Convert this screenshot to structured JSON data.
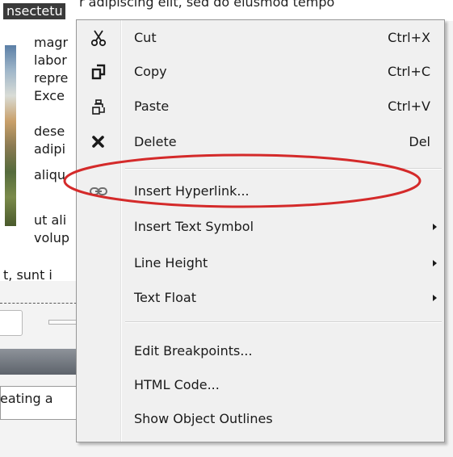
{
  "document": {
    "selected_word": "nsectetu",
    "top_line_text": "r adipiscing elit, sed do eiusmod tempo",
    "side_lines": [
      "magr",
      "labor",
      "repre",
      "Exce",
      "dese",
      "adipi",
      "aliqu",
      "ut ali",
      "volup"
    ],
    "bottom_line": "t, sunt i",
    "status_text": "eating a"
  },
  "context_menu": {
    "items": [
      {
        "label": "Cut",
        "shortcut": "Ctrl+X",
        "icon": "scissors-icon"
      },
      {
        "label": "Copy",
        "shortcut": "Ctrl+C",
        "icon": "copy-icon"
      },
      {
        "label": "Paste",
        "shortcut": "Ctrl+V",
        "icon": "paste-icon"
      },
      {
        "label": "Delete",
        "shortcut": "Del",
        "icon": "delete-x-icon"
      },
      {
        "label": "Insert Hyperlink...",
        "shortcut": "",
        "icon": "link-chain-icon"
      },
      {
        "label": "Insert Text Symbol",
        "shortcut": "",
        "icon": "",
        "submenu": true
      },
      {
        "label": "Line Height",
        "shortcut": "",
        "icon": "",
        "submenu": true
      },
      {
        "label": "Text Float",
        "shortcut": "",
        "icon": "",
        "submenu": true
      },
      {
        "label": "Edit Breakpoints...",
        "shortcut": "",
        "icon": ""
      },
      {
        "label": "HTML Code...",
        "shortcut": "",
        "icon": ""
      },
      {
        "label": "Show Object Outlines",
        "shortcut": "",
        "icon": ""
      }
    ]
  },
  "annotation": {
    "highlighted_item": "Insert Hyperlink...",
    "ellipse_color": "#d42a2a"
  }
}
